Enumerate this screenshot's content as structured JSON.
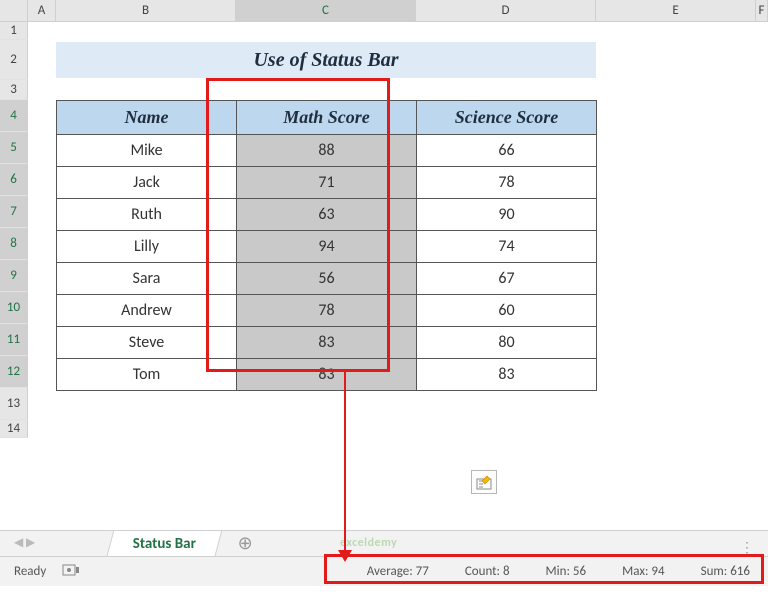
{
  "columns": [
    "A",
    "B",
    "C",
    "D",
    "E",
    "F"
  ],
  "rows": [
    "1",
    "2",
    "3",
    "4",
    "5",
    "6",
    "7",
    "8",
    "9",
    "10",
    "11",
    "12",
    "13",
    "14"
  ],
  "active_column": "C",
  "title": "Use of Status Bar",
  "headers": {
    "name": "Name",
    "math": "Math Score",
    "science": "Science Score"
  },
  "data": [
    {
      "name": "Mike",
      "math": 88,
      "science": 66
    },
    {
      "name": "Jack",
      "math": 71,
      "science": 78
    },
    {
      "name": "Ruth",
      "math": 63,
      "science": 90
    },
    {
      "name": "Lilly",
      "math": 94,
      "science": 74
    },
    {
      "name": "Sara",
      "math": 56,
      "science": 67
    },
    {
      "name": "Andrew",
      "math": 78,
      "science": 60
    },
    {
      "name": "Steve",
      "math": 83,
      "science": 80
    },
    {
      "name": "Tom",
      "math": 83,
      "science": 83
    }
  ],
  "sheet_tab": "Status Bar",
  "status": {
    "ready": "Ready",
    "average_label": "Average:",
    "average": 77,
    "count_label": "Count:",
    "count": 8,
    "min_label": "Min:",
    "min": 56,
    "max_label": "Max:",
    "max": 94,
    "sum_label": "Sum:",
    "sum": 616
  },
  "watermark": "exceldemy"
}
